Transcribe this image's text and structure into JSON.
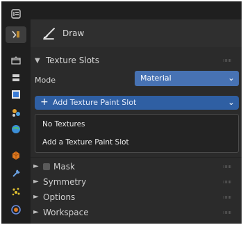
{
  "sidebar": {
    "icons": [
      "editor-type-icon",
      "tool-settings-icon",
      "render-icon",
      "output-icon",
      "view-layer-icon",
      "scene-icon",
      "world-icon",
      "object-icon",
      "modifier-icon",
      "particles-icon",
      "physics-icon"
    ]
  },
  "tool": {
    "name": "Draw"
  },
  "texture_slots": {
    "title": "Texture Slots",
    "mode_label": "Mode",
    "mode_value": "Material",
    "add_button_label": "Add Texture Paint Slot",
    "popup_items": [
      "No Textures",
      "Add a Texture Paint Slot"
    ]
  },
  "panels": {
    "mask": "Mask",
    "symmetry": "Symmetry",
    "options": "Options",
    "workspace": "Workspace"
  },
  "colors": {
    "accent": "#4772b3",
    "background": "#2b2b2b"
  }
}
